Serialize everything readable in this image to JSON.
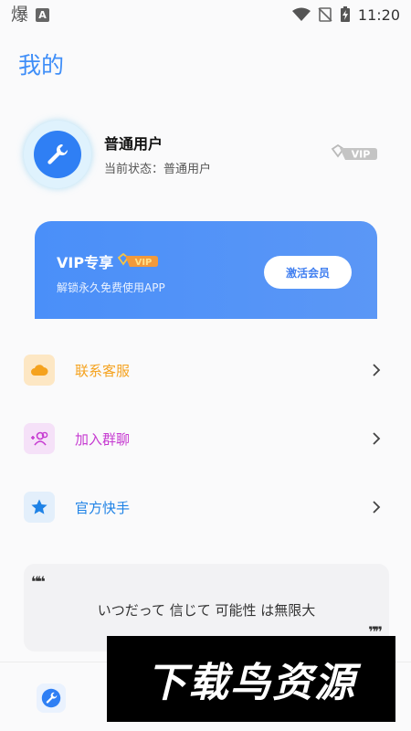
{
  "status_bar": {
    "left_glyph": "爆",
    "notification_badge": "A",
    "time": "11:20",
    "icons": [
      "wifi-icon",
      "no-sim-icon",
      "battery-charging-icon"
    ]
  },
  "page": {
    "title": "我的"
  },
  "profile": {
    "name": "普通用户",
    "status_label": "当前状态：普通用户",
    "avatar_icon": "wrench-icon",
    "badge": "VIP"
  },
  "vip_banner": {
    "title": "VIP专享",
    "badge": "VIP",
    "subtitle": "解锁永久免费使用APP",
    "button_label": "激活会员",
    "color": "#4a8ff9"
  },
  "menu": {
    "items": [
      {
        "label": "联系客服",
        "icon": "cloud-icon",
        "color": "#f5a21e",
        "bg": "#fde7c4"
      },
      {
        "label": "加入群聊",
        "icon": "add-group-icon",
        "color": "#c63bd1",
        "bg": "#f5e1f8"
      },
      {
        "label": "官方快手",
        "icon": "star-icon",
        "color": "#1e82e6",
        "bg": "#e3effb"
      }
    ]
  },
  "quote": {
    "text": "いつだって 信じて 可能性 は無限大",
    "open_mark": "❝❝",
    "close_mark": "❞❞"
  },
  "bottom": {
    "icon": "wrench-icon"
  },
  "watermark": {
    "text": "下载鸟资源"
  }
}
